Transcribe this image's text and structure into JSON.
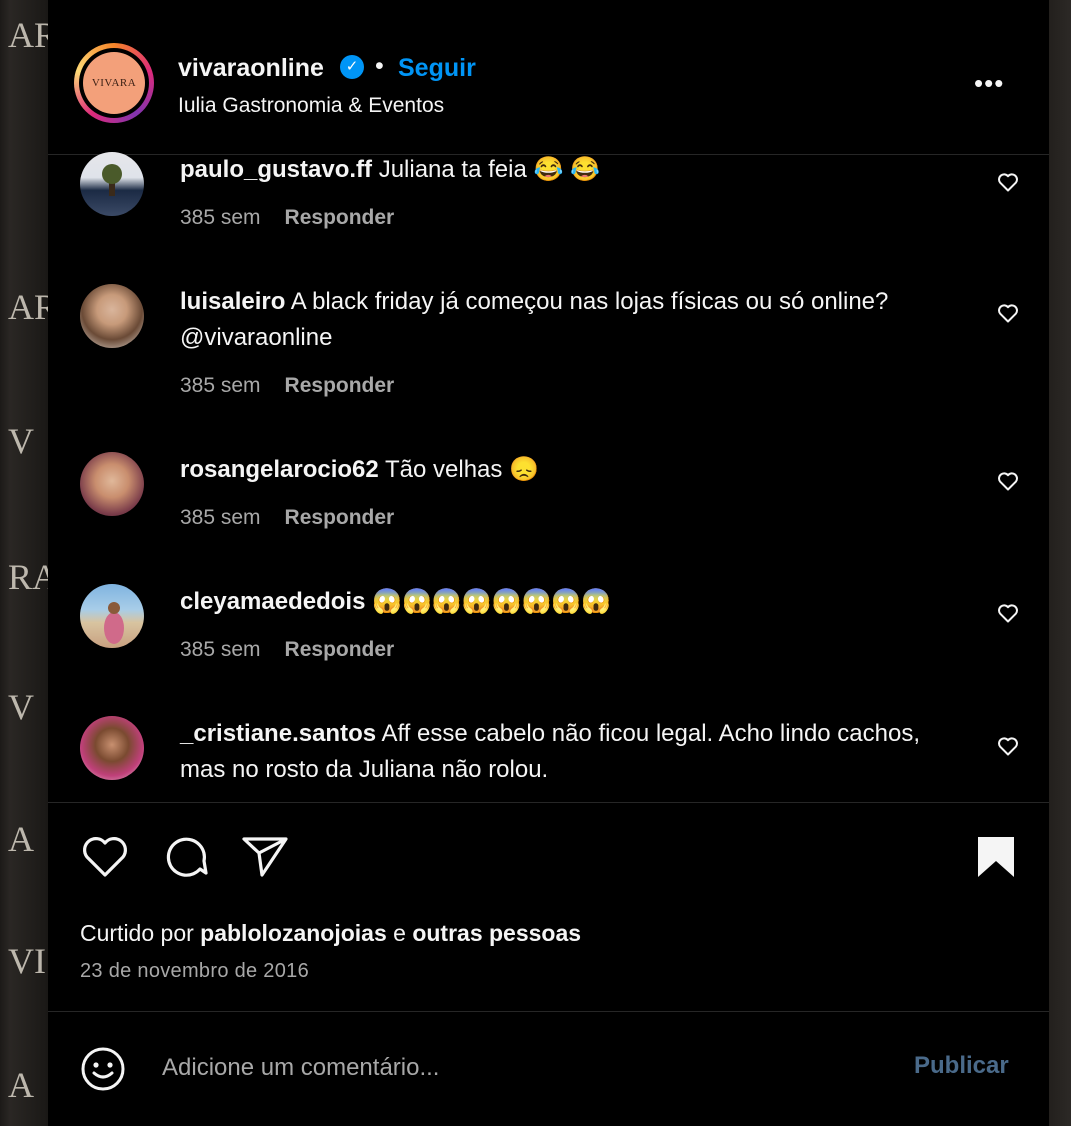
{
  "header": {
    "logo_text": "VIVARA",
    "username": "vivaraonline",
    "separator": "•",
    "follow_label": "Seguir",
    "subtitle": "Iulia Gastronomia & Eventos",
    "more_label": "•••"
  },
  "comments": [
    {
      "username": "paulo_gustavo.ff",
      "text": "Juliana ta feia 😂 😂",
      "time": "385 sem",
      "reply": "Responder"
    },
    {
      "username": "luisaleiro",
      "text": "A black friday já começou nas lojas físicas ou só online?@vivaraonline",
      "time": "385 sem",
      "reply": "Responder"
    },
    {
      "username": "rosangelarocio62",
      "text": "Tão velhas 😞",
      "time": "385 sem",
      "reply": "Responder"
    },
    {
      "username": "cleyamaededois",
      "text": "😱😱😱😱😱😱😱😱",
      "time": "385 sem",
      "reply": "Responder"
    },
    {
      "username": "_cristiane.santos",
      "text": "Aff esse cabelo não ficou legal. Acho lindo cachos, mas no rosto da Juliana não rolou."
    }
  ],
  "likes": {
    "prefix": "Curtido por",
    "user": "pablolozanojoias",
    "connector": "e",
    "others": "outras pessoas"
  },
  "date": "23 de novembro de 2016",
  "comment_input": {
    "placeholder": "Adicione um comentário...",
    "publish_label": "Publicar"
  },
  "background_letters": [
    "AR",
    "AR",
    "V",
    "RA",
    "V",
    "A",
    "VI",
    "A"
  ],
  "colors": {
    "accent": "#0095f6",
    "publish_disabled": "#4a6a8a",
    "text_secondary": "#a8a8a8",
    "logo_bg": "#f3a07a"
  }
}
